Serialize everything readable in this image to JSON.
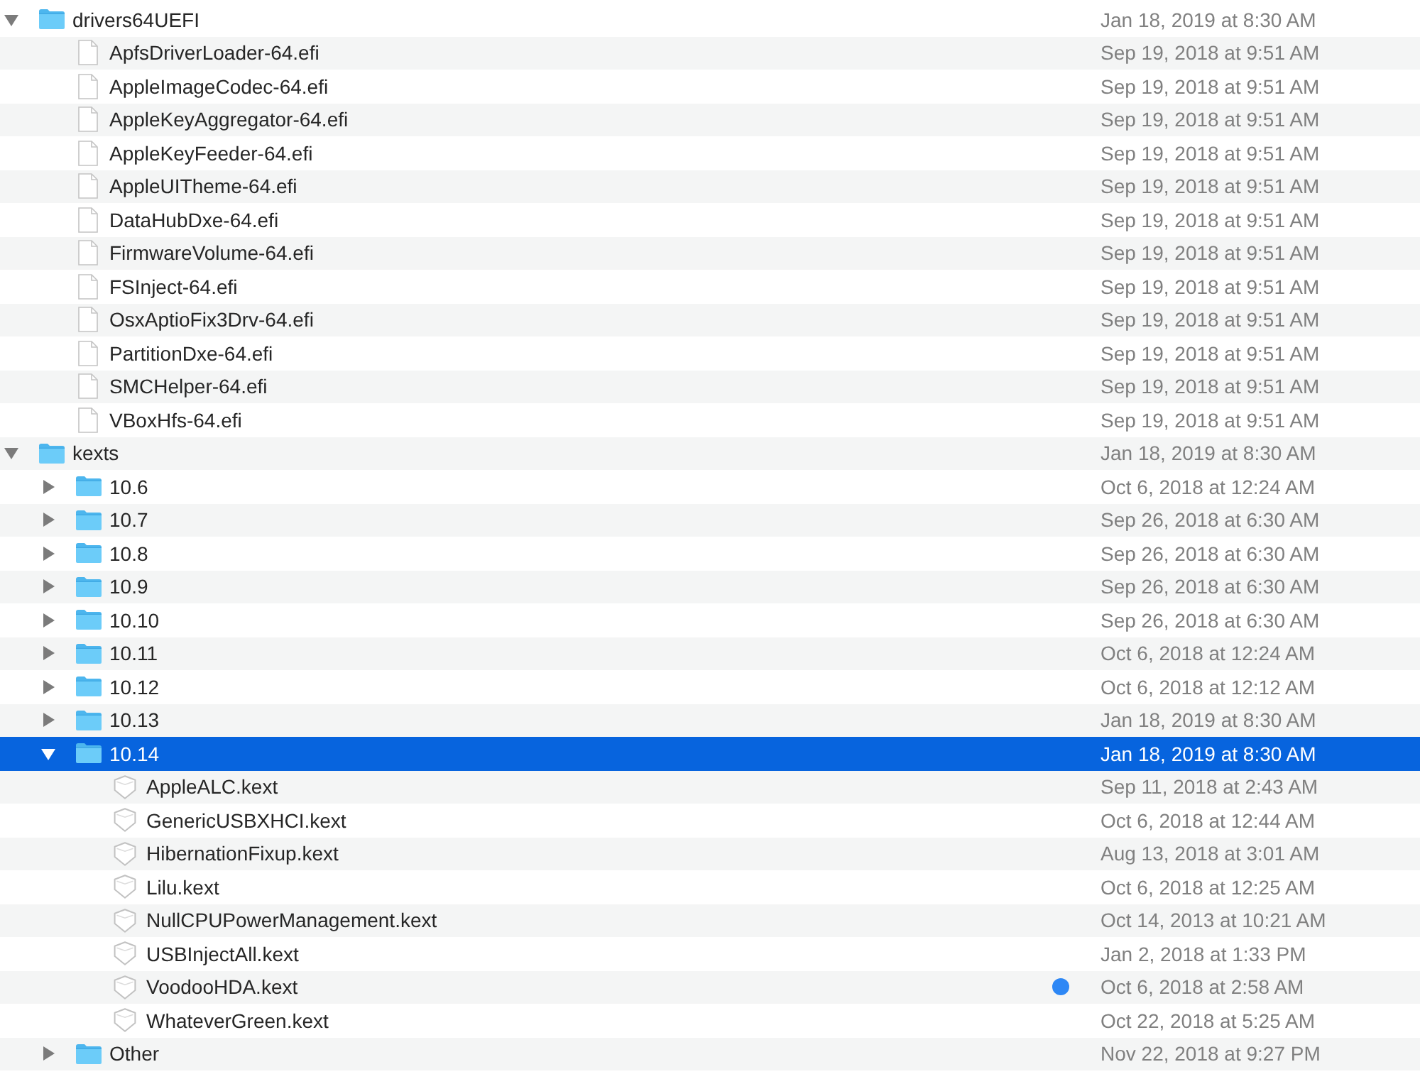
{
  "items": [
    {
      "kind": "folder",
      "name": "drivers64UEFI",
      "date": "Jan 18, 2019 at 8:30 AM",
      "expanded": true,
      "selected": false,
      "children": [
        {
          "kind": "file",
          "name": "ApfsDriverLoader-64.efi",
          "date": "Sep 19, 2018 at 9:51 AM",
          "selected": false
        },
        {
          "kind": "file",
          "name": "AppleImageCodec-64.efi",
          "date": "Sep 19, 2018 at 9:51 AM",
          "selected": false
        },
        {
          "kind": "file",
          "name": "AppleKeyAggregator-64.efi",
          "date": "Sep 19, 2018 at 9:51 AM",
          "selected": false
        },
        {
          "kind": "file",
          "name": "AppleKeyFeeder-64.efi",
          "date": "Sep 19, 2018 at 9:51 AM",
          "selected": false
        },
        {
          "kind": "file",
          "name": "AppleUITheme-64.efi",
          "date": "Sep 19, 2018 at 9:51 AM",
          "selected": false
        },
        {
          "kind": "file",
          "name": "DataHubDxe-64.efi",
          "date": "Sep 19, 2018 at 9:51 AM",
          "selected": false
        },
        {
          "kind": "file",
          "name": "FirmwareVolume-64.efi",
          "date": "Sep 19, 2018 at 9:51 AM",
          "selected": false
        },
        {
          "kind": "file",
          "name": "FSInject-64.efi",
          "date": "Sep 19, 2018 at 9:51 AM",
          "selected": false
        },
        {
          "kind": "file",
          "name": "OsxAptioFix3Drv-64.efi",
          "date": "Sep 19, 2018 at 9:51 AM",
          "selected": false
        },
        {
          "kind": "file",
          "name": "PartitionDxe-64.efi",
          "date": "Sep 19, 2018 at 9:51 AM",
          "selected": false
        },
        {
          "kind": "file",
          "name": "SMCHelper-64.efi",
          "date": "Sep 19, 2018 at 9:51 AM",
          "selected": false
        },
        {
          "kind": "file",
          "name": "VBoxHfs-64.efi",
          "date": "Sep 19, 2018 at 9:51 AM",
          "selected": false
        }
      ]
    },
    {
      "kind": "folder",
      "name": "kexts",
      "date": "Jan 18, 2019 at 8:30 AM",
      "expanded": true,
      "selected": false,
      "children": [
        {
          "kind": "folder",
          "name": "10.6",
          "date": "Oct 6, 2018 at 12:24 AM",
          "expanded": false,
          "selected": false
        },
        {
          "kind": "folder",
          "name": "10.7",
          "date": "Sep 26, 2018 at 6:30 AM",
          "expanded": false,
          "selected": false
        },
        {
          "kind": "folder",
          "name": "10.8",
          "date": "Sep 26, 2018 at 6:30 AM",
          "expanded": false,
          "selected": false
        },
        {
          "kind": "folder",
          "name": "10.9",
          "date": "Sep 26, 2018 at 6:30 AM",
          "expanded": false,
          "selected": false
        },
        {
          "kind": "folder",
          "name": "10.10",
          "date": "Sep 26, 2018 at 6:30 AM",
          "expanded": false,
          "selected": false
        },
        {
          "kind": "folder",
          "name": "10.11",
          "date": "Oct 6, 2018 at 12:24 AM",
          "expanded": false,
          "selected": false
        },
        {
          "kind": "folder",
          "name": "10.12",
          "date": "Oct 6, 2018 at 12:12 AM",
          "expanded": false,
          "selected": false
        },
        {
          "kind": "folder",
          "name": "10.13",
          "date": "Jan 18, 2019 at 8:30 AM",
          "expanded": false,
          "selected": false
        },
        {
          "kind": "folder",
          "name": "10.14",
          "date": "Jan 18, 2019 at 8:30 AM",
          "expanded": true,
          "selected": true,
          "children": [
            {
              "kind": "kext",
              "name": "AppleALC.kext",
              "date": "Sep 11, 2018 at 2:43 AM",
              "selected": false
            },
            {
              "kind": "kext",
              "name": "GenericUSBXHCI.kext",
              "date": "Oct 6, 2018 at 12:44 AM",
              "selected": false
            },
            {
              "kind": "kext",
              "name": "HibernationFixup.kext",
              "date": "Aug 13, 2018 at 3:01 AM",
              "selected": false
            },
            {
              "kind": "kext",
              "name": "Lilu.kext",
              "date": "Oct 6, 2018 at 12:25 AM",
              "selected": false
            },
            {
              "kind": "kext",
              "name": "NullCPUPowerManagement.kext",
              "date": "Oct 14, 2013 at 10:21 AM",
              "selected": false
            },
            {
              "kind": "kext",
              "name": "USBInjectAll.kext",
              "date": "Jan 2, 2018 at 1:33 PM",
              "selected": false
            },
            {
              "kind": "kext",
              "name": "VoodooHDA.kext",
              "date": "Oct 6, 2018 at 2:58 AM",
              "selected": false,
              "color": "#2d87f5"
            },
            {
              "kind": "kext",
              "name": "WhateverGreen.kext",
              "date": "Oct 22, 2018 at 5:25 AM",
              "selected": false
            }
          ]
        },
        {
          "kind": "folder",
          "name": "Other",
          "date": "Nov 22, 2018 at 9:27 PM",
          "expanded": false,
          "selected": false
        }
      ]
    }
  ]
}
